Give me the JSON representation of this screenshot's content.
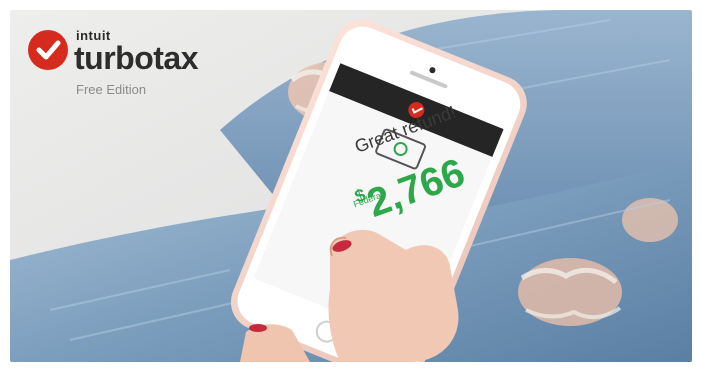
{
  "logo": {
    "company": "intuit",
    "product": "turbotax",
    "edition": "Free Edition",
    "brand_color": "#d52b1e"
  },
  "phone_screen": {
    "headline": "Great refund!",
    "currency": "$",
    "amount": "2,766",
    "amount_color": "#2ca84a",
    "sub_label": "Federal"
  }
}
